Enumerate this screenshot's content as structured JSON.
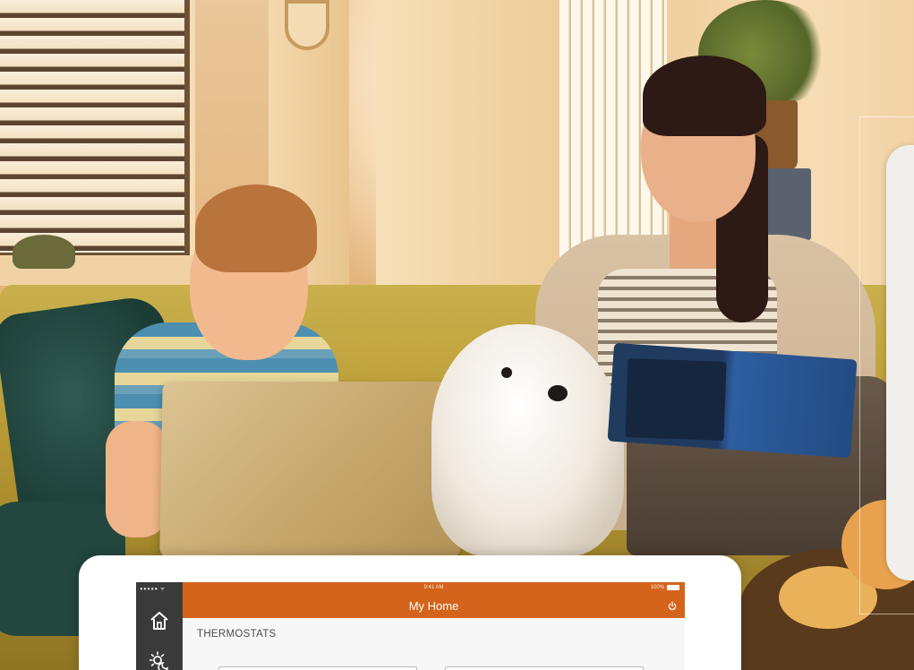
{
  "app": {
    "status_carrier": "●●●●● ᯤ",
    "status_time": "9:41 AM",
    "status_battery": "100%",
    "title": "My Home"
  },
  "sidebar": {
    "items": [
      {
        "icon": "home-icon"
      },
      {
        "icon": "weather-sun-moon-icon"
      }
    ]
  },
  "header": {
    "action_icon": "power-icon"
  },
  "content": {
    "section_title": "THERMOSTATS",
    "thermostat_cards": [
      {
        "id": "card-1"
      },
      {
        "id": "card-2"
      }
    ]
  },
  "colors": {
    "accent": "#d4641c",
    "sidebar": "#3a3a3a",
    "background": "#f7f7f7"
  }
}
